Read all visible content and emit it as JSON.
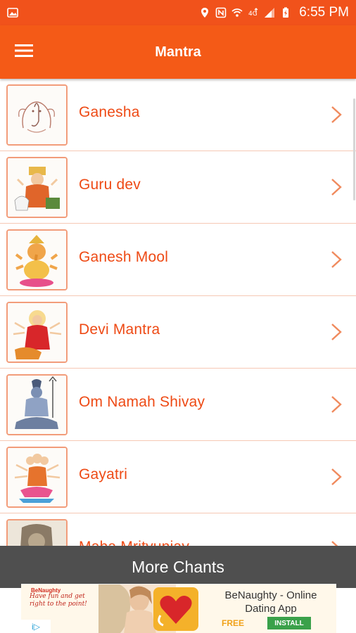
{
  "status_bar": {
    "time": "6:55 PM",
    "icons": [
      "image-icon",
      "location-icon",
      "nfc-icon",
      "wifi-icon",
      "4g-icon",
      "signal-icon",
      "battery-icon"
    ]
  },
  "app_bar": {
    "title": "Mantra",
    "menu_icon": "hamburger-menu-icon"
  },
  "mantras": [
    {
      "label": "Ganesha",
      "thumb_icon": "ganesha-sketch-image"
    },
    {
      "label": "Guru dev",
      "thumb_icon": "guru-dev-image"
    },
    {
      "label": "Ganesh Mool",
      "thumb_icon": "ganesh-mool-image"
    },
    {
      "label": "Devi Mantra",
      "thumb_icon": "devi-image"
    },
    {
      "label": "Om Namah Shivay",
      "thumb_icon": "shiva-image"
    },
    {
      "label": "Gayatri",
      "thumb_icon": "gayatri-image"
    },
    {
      "label": "Maha Mrityunjay",
      "thumb_icon": "maha-mrityunjay-image"
    }
  ],
  "more_chants": {
    "label": "More Chants"
  },
  "ad": {
    "brand": "BeNaughty",
    "tagline": "Have fun and get right to the point!",
    "title": "BeNaughty - Online Dating App",
    "price": "FREE",
    "install": "INSTALL",
    "adchoices": "i▷"
  },
  "colors": {
    "status_bar": "#f1521b",
    "app_bar": "#f45a17",
    "label_text": "#ee4a15",
    "chevron": "#f08a5d",
    "divider": "#f6c8b4"
  }
}
